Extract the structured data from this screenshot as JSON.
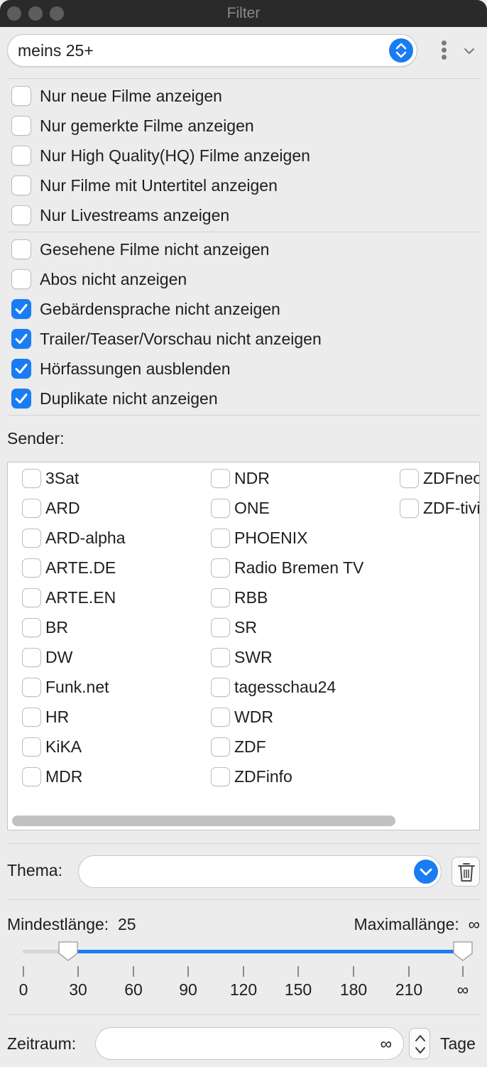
{
  "window": {
    "title": "Filter"
  },
  "preset": {
    "value": "meins 25+"
  },
  "filters_group1": [
    {
      "label": "Nur neue Filme anzeigen",
      "checked": false
    },
    {
      "label": "Nur gemerkte Filme anzeigen",
      "checked": false
    },
    {
      "label": "Nur High Quality(HQ) Filme anzeigen",
      "checked": false
    },
    {
      "label": "Nur Filme mit Untertitel anzeigen",
      "checked": false
    },
    {
      "label": "Nur Livestreams anzeigen",
      "checked": false
    }
  ],
  "filters_group2": [
    {
      "label": "Gesehene Filme nicht anzeigen",
      "checked": false
    },
    {
      "label": "Abos nicht anzeigen",
      "checked": false
    },
    {
      "label": "Gebärdensprache nicht anzeigen",
      "checked": true
    },
    {
      "label": "Trailer/Teaser/Vorschau nicht anzeigen",
      "checked": true
    },
    {
      "label": "Hörfassungen ausblenden",
      "checked": true
    },
    {
      "label": "Duplikate nicht anzeigen",
      "checked": true
    }
  ],
  "sender": {
    "label": "Sender:",
    "columns": [
      [
        "3Sat",
        "ARD",
        "ARD-alpha",
        "ARTE.DE",
        "ARTE.EN",
        "BR",
        "DW",
        "Funk.net",
        "HR",
        "KiKA",
        "MDR"
      ],
      [
        "NDR",
        "ONE",
        "PHOENIX",
        "Radio Bremen TV",
        "RBB",
        "SR",
        "SWR",
        "tagesschau24",
        "WDR",
        "ZDF",
        "ZDFinfo"
      ],
      [
        "ZDFneo",
        "ZDF-tivi"
      ]
    ]
  },
  "thema": {
    "label": "Thema:",
    "value": ""
  },
  "length": {
    "min_label": "Mindestlänge:",
    "min_value": "25",
    "max_label": "Maximallänge:",
    "max_value": "∞",
    "ticks": [
      "0",
      "30",
      "60",
      "90",
      "120",
      "150",
      "180",
      "210",
      "∞"
    ]
  },
  "zeitraum": {
    "label": "Zeitraum:",
    "value": "∞",
    "unit": "Tage"
  },
  "colors": {
    "accent": "#1a7cf3"
  }
}
